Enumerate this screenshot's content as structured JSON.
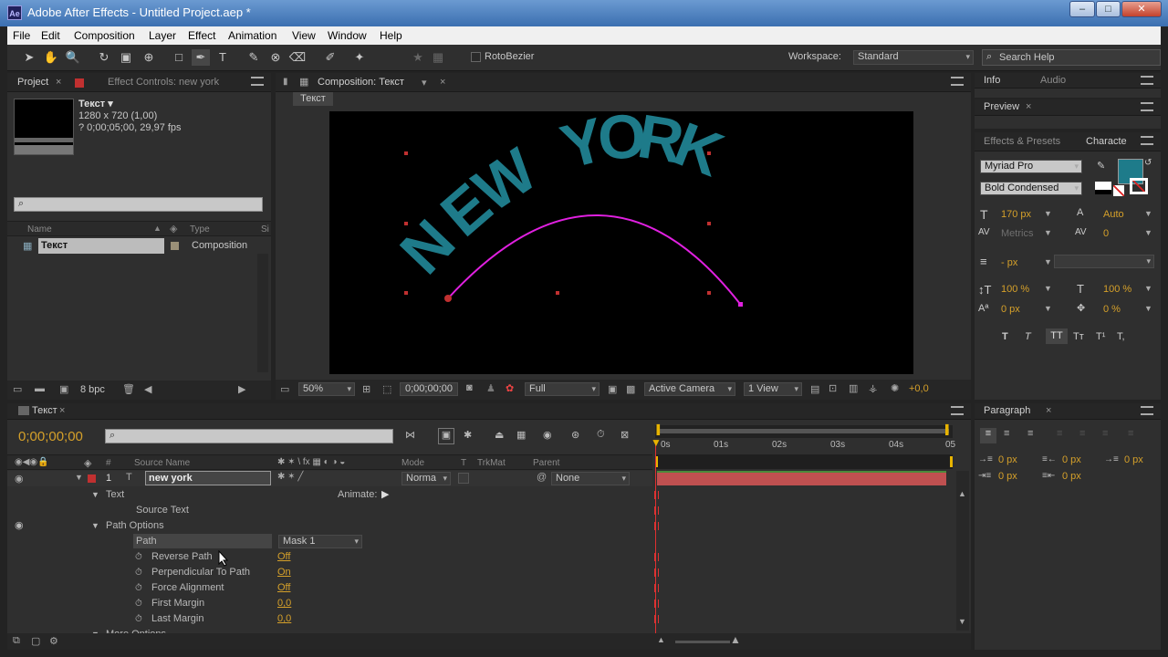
{
  "window": {
    "title": "Adobe After Effects - Untitled Project.aep *",
    "app_icon": "Ae"
  },
  "menu": [
    "File",
    "Edit",
    "Composition",
    "Layer",
    "Effect",
    "Animation",
    "View",
    "Window",
    "Help"
  ],
  "toolbar": {
    "rotobezier": "RotoBezier",
    "workspace_label": "Workspace:",
    "workspace_value": "Standard",
    "search_placeholder": "Search Help"
  },
  "project": {
    "tab": "Project",
    "tab2": "Effect Controls: new york",
    "item_name": "Текст ▾",
    "item_size": "1280 x 720 (1,00)",
    "item_dur": "? 0;00;05;00, 29,97 fps",
    "col_name": "Name",
    "col_type": "Type",
    "col_size": "Si",
    "rows": [
      {
        "name": "Текст",
        "type": "Composition"
      }
    ],
    "bpc": "8 bpc"
  },
  "comp": {
    "tab": "Composition: Текст",
    "breadcrumb": "Текст",
    "text_chars": [
      "N",
      "E",
      "W",
      " ",
      "Y",
      "O",
      "R",
      "K"
    ],
    "zoom": "50%",
    "timecode": "0;00;00;00",
    "resolution": "Full",
    "camera": "Active Camera",
    "view": "1 View",
    "exposure": "+0,0"
  },
  "info": {
    "tab1": "Info",
    "tab2": "Audio",
    "preview": "Preview",
    "effects": "Effects & Presets",
    "character": "Characte"
  },
  "character": {
    "font": "Myriad Pro",
    "style": "Bold Condensed",
    "size": "170 px",
    "leading": "Auto",
    "kerning": "Metrics",
    "tracking": "0",
    "stroke": "- px",
    "vscale": "100 %",
    "hscale": "100 %",
    "baseline": "0 px",
    "tsume": "0 %",
    "fill_color": "#1e7b8a",
    "styles": [
      "T",
      "T",
      "TT",
      "Tт",
      "T¹",
      "T,"
    ]
  },
  "paragraph": {
    "tab": "Paragraph",
    "indent_left": "0 px",
    "indent_first": "0 px",
    "indent_right": "0 px",
    "space_before": "0 px",
    "space_after": "0 px"
  },
  "timeline": {
    "tab": "Текст",
    "timecode": "0;00;00;00",
    "cols": {
      "source": "Source Name",
      "mode": "Mode",
      "t": "T",
      "trkmat": "TrkMat",
      "parent": "Parent"
    },
    "ruler": [
      "0s",
      "01s",
      "02s",
      "03s",
      "04s",
      "05"
    ],
    "layer": {
      "num": "1",
      "name": "new york",
      "mode": "Norma",
      "parent": "None"
    },
    "animate": "Animate:",
    "rows": [
      {
        "label": "Text",
        "indent": 1,
        "value": ""
      },
      {
        "label": "Source Text",
        "indent": 2,
        "value": ""
      },
      {
        "label": "Path Options",
        "indent": 1,
        "value": ""
      },
      {
        "label": "Path",
        "indent": 2,
        "value": "Mask 1"
      },
      {
        "label": "Reverse Path",
        "indent": 3,
        "value": "Off"
      },
      {
        "label": "Perpendicular To Path",
        "indent": 3,
        "value": "On"
      },
      {
        "label": "Force Alignment",
        "indent": 3,
        "value": "Off"
      },
      {
        "label": "First Margin",
        "indent": 3,
        "value": "0,0"
      },
      {
        "label": "Last Margin",
        "indent": 3,
        "value": "0,0"
      },
      {
        "label": "More Options",
        "indent": 1,
        "value": ""
      }
    ]
  }
}
